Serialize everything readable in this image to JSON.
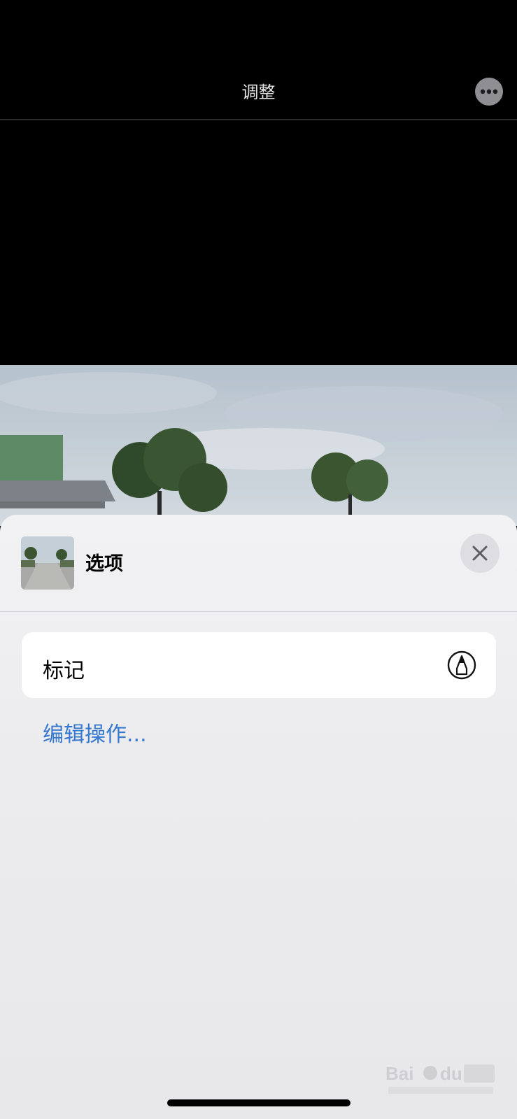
{
  "header": {
    "title": "调整",
    "more_icon": "ellipsis-icon"
  },
  "sheet": {
    "title": "选项",
    "close_icon": "close-icon",
    "actions": [
      {
        "label": "标记",
        "icon": "markup-pen-icon"
      }
    ],
    "edit_actions_label": "编辑操作..."
  },
  "colors": {
    "link": "#3478d0",
    "sheet_background": "#efeff1",
    "top_background": "#000000"
  }
}
